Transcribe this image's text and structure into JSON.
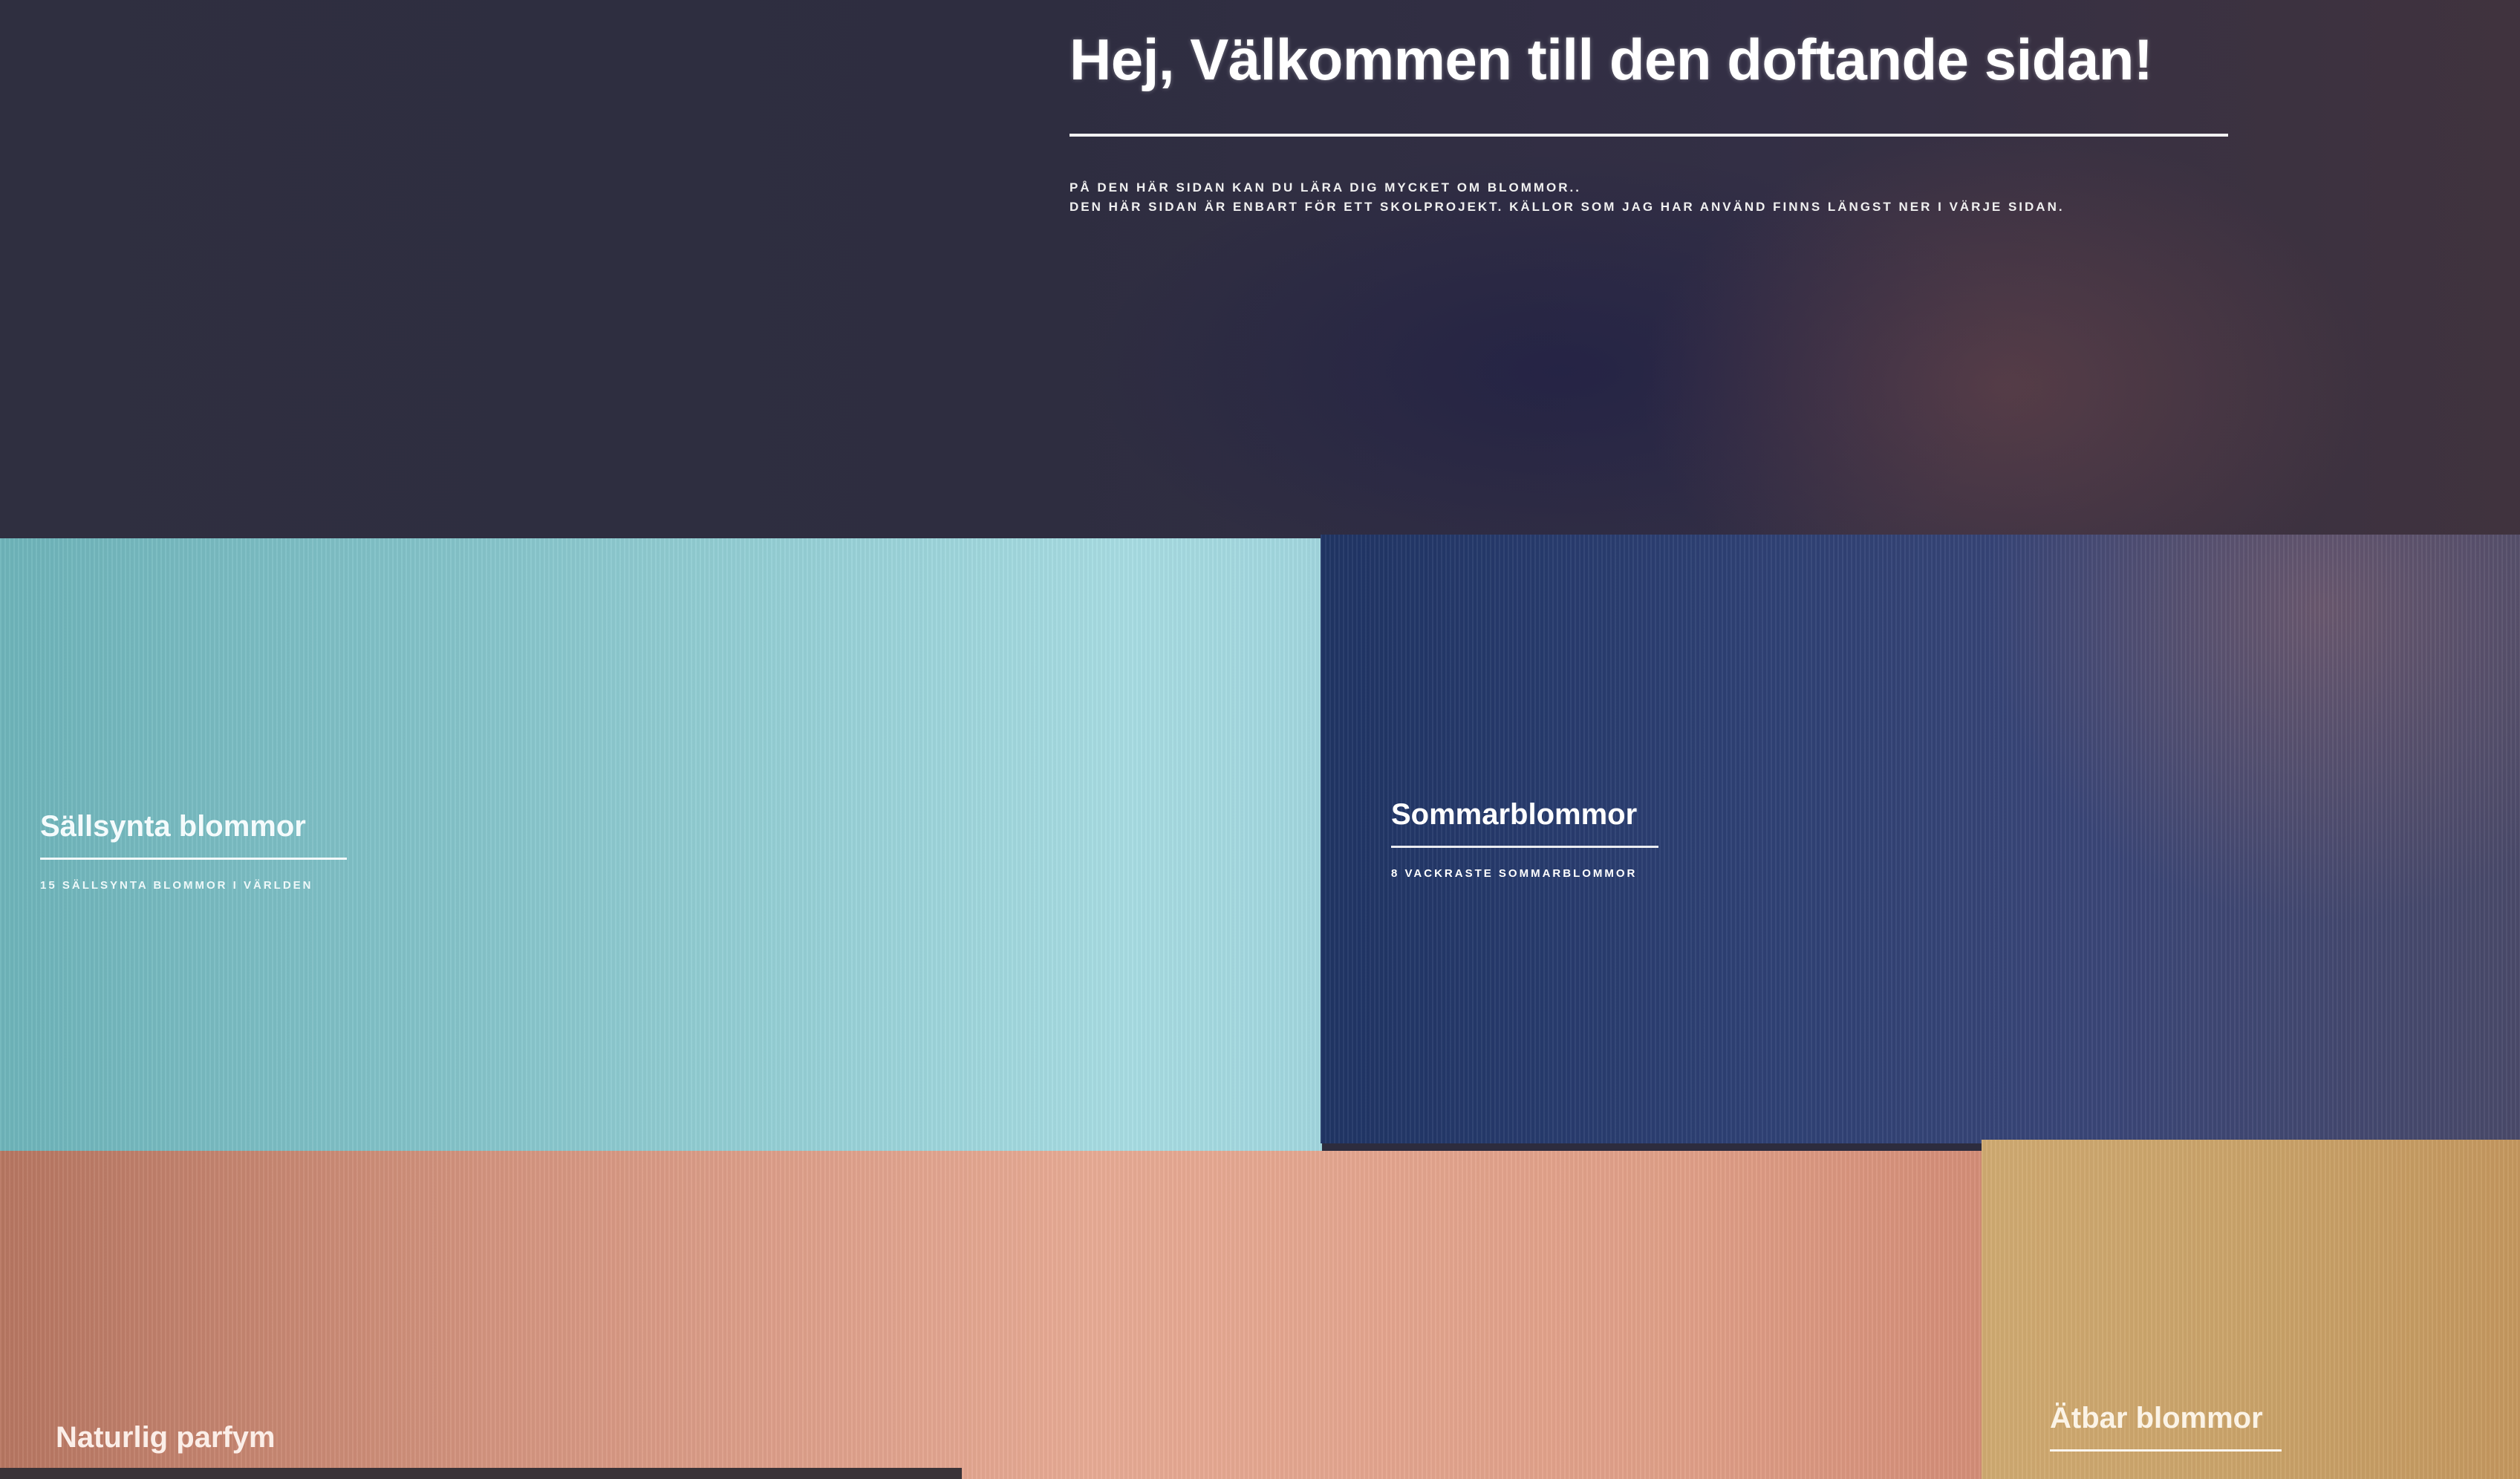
{
  "hero": {
    "title": "Hej, Välkommen till den doftande sidan!",
    "line1": "På den här sidan kan du lära dig mycket om blommor..",
    "line2": "Den här sidan är enbart för ett skolprojekt. Källor som jag har använd finns längst ner i värje sidan."
  },
  "tiles": [
    {
      "title": "Sällsynta blommor",
      "subtitle": "15 sällsynta blommor i världen"
    },
    {
      "title": "Sommarblommor",
      "subtitle": "8 vackraste sommarblommor"
    },
    {
      "title": "Naturlig parfym"
    },
    {
      "title": "Ätbar blommor"
    }
  ],
  "colors": {
    "hero_bg": "#2f2f40",
    "rare_bg": "#8cc9cf",
    "summer_bg": "#2e4175",
    "perfume_bg": "#e8ab95",
    "edible_bg": "#cba46a"
  }
}
